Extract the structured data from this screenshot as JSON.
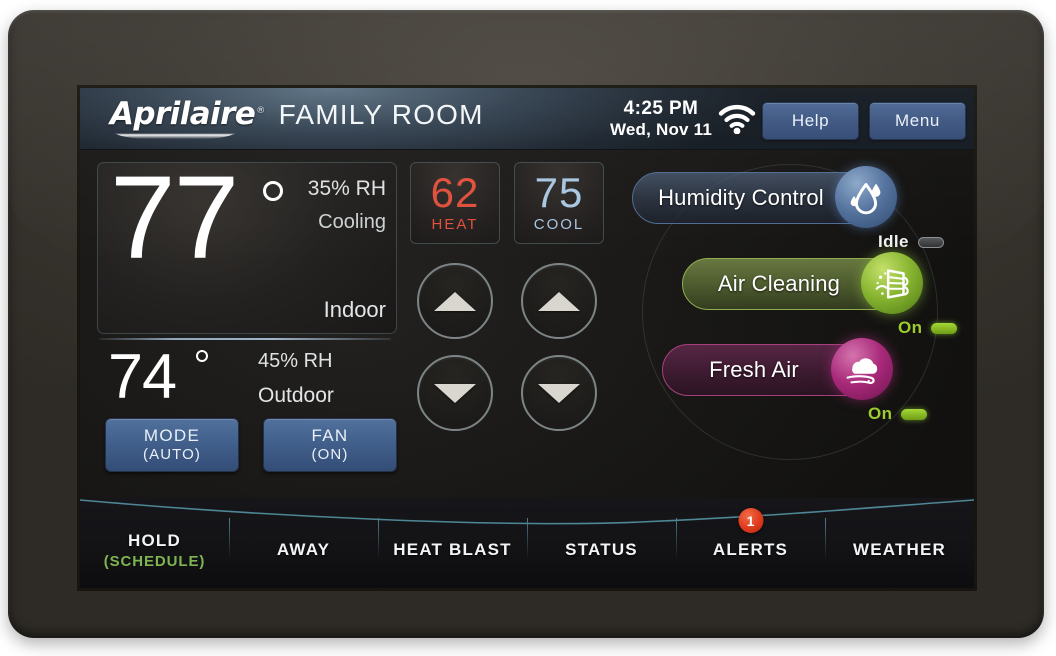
{
  "device": {
    "brand": "Aprilaire",
    "registered_mark": "®"
  },
  "header": {
    "room_name": "FAMILY ROOM",
    "time": "4:25 PM",
    "date": "Wed, Nov 11",
    "wifi_icon": "wifi-icon",
    "help_label": "Help",
    "menu_label": "Menu"
  },
  "indoor": {
    "temperature": "77",
    "degree_symbol": "°",
    "humidity": "35% RH",
    "mode_status": "Cooling",
    "label": "Indoor"
  },
  "outdoor": {
    "temperature": "74",
    "degree_symbol": "°",
    "humidity": "45% RH",
    "label": "Outdoor"
  },
  "controls": {
    "mode_label": "MODE",
    "mode_value": "(AUTO)",
    "fan_label": "FAN",
    "fan_value": "(ON)"
  },
  "setpoints": {
    "heat_value": "62",
    "heat_label": "HEAT",
    "heat_color": "#e0503c",
    "cool_value": "75",
    "cool_label": "COOL",
    "cool_color": "#a9c6e2",
    "heat_up_icon": "triangle-up-icon",
    "heat_down_icon": "triangle-down-icon",
    "cool_up_icon": "triangle-up-icon",
    "cool_down_icon": "triangle-down-icon"
  },
  "features": [
    {
      "name": "Humidity Control",
      "icon": "water-drop-icon",
      "status": "Idle",
      "status_color": "#f2f3f3",
      "accent": "#4e6d94"
    },
    {
      "name": "Air Cleaning",
      "icon": "air-filter-icon",
      "status": "On",
      "status_color": "#9ccd2c",
      "accent": "#8fae4e"
    },
    {
      "name": "Fresh Air",
      "icon": "cloud-wind-icon",
      "status": "On",
      "status_color": "#9ccd2c",
      "accent": "#a8407e"
    }
  ],
  "tabs": [
    {
      "label": "HOLD",
      "sublabel": "(SCHEDULE)",
      "badge": null
    },
    {
      "label": "AWAY",
      "sublabel": null,
      "badge": null
    },
    {
      "label": "HEAT BLAST",
      "sublabel": null,
      "badge": null
    },
    {
      "label": "STATUS",
      "sublabel": null,
      "badge": null
    },
    {
      "label": "ALERTS",
      "sublabel": null,
      "badge": "1"
    },
    {
      "label": "WEATHER",
      "sublabel": null,
      "badge": null
    }
  ]
}
